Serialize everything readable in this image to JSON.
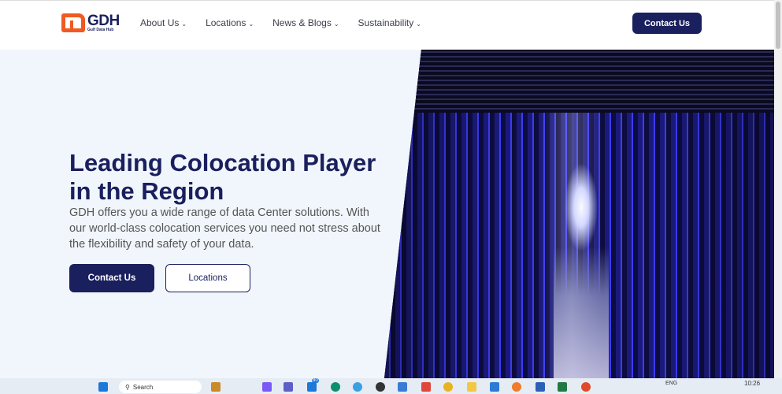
{
  "header": {
    "logo_title": "GDH",
    "logo_subtitle": "Gulf Data Hub",
    "nav": [
      {
        "label": "About Us"
      },
      {
        "label": "Locations"
      },
      {
        "label": "News & Blogs"
      },
      {
        "label": "Sustainability"
      }
    ],
    "chevron": "⌄",
    "contact_label": "Contact Us"
  },
  "hero": {
    "title": "Leading Colocation Player in the Region",
    "description": "GDH offers you a wide range of data Center solutions. With our world-class colocation services you need not stress about the flexibility and safety of your data.",
    "primary_button": "Contact Us",
    "secondary_button": "Locations"
  },
  "taskbar": {
    "search_placeholder": "Search",
    "language": "ENG",
    "time": "10:26",
    "badge": "80"
  },
  "colors": {
    "brand": "#1a1f5e",
    "accent": "#f05a22",
    "hero_bg": "#f0f6fb"
  }
}
